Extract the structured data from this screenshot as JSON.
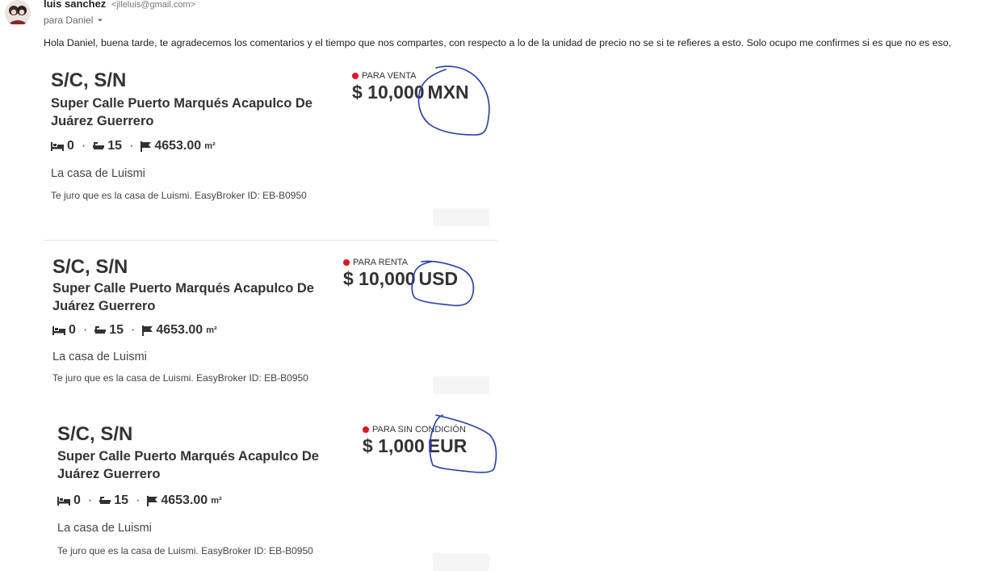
{
  "email": {
    "sender_name": "luis sanchez",
    "sender_email": "<jlleluis@gmail.com>",
    "recipient": "para Daniel",
    "body": "Hola Daniel, buena tarde, te agradecemos los comentarios y el tiempo que nos compartes, con respecto a lo de la unidad de precio no se si te refieres a esto. Solo ocupo me confirmes si es que no es eso,"
  },
  "listings": [
    {
      "address": "S/C, S/N",
      "street": "Super Calle Puerto Marqués Acapulco De Juárez Guerrero",
      "bedrooms": "0",
      "bathrooms": "15",
      "area": "4653.00",
      "area_unit": "m²",
      "summary": "La casa de Luismi",
      "description": "Te juro que es la casa de Luismi. EasyBroker ID: EB-B0950",
      "operation": "PARA VENTA",
      "price": "$ 10,000",
      "currency": "MXN"
    },
    {
      "address": "S/C, S/N",
      "street": "Super Calle Puerto Marqués Acapulco De Juárez Guerrero",
      "bedrooms": "0",
      "bathrooms": "15",
      "area": "4653.00",
      "area_unit": "m²",
      "summary": "La casa de Luismi",
      "description": "Te juro que es la casa de Luismi. EasyBroker ID: EB-B0950",
      "operation": "PARA RENTA",
      "price": "$ 10,000",
      "currency": "USD"
    },
    {
      "address": "S/C, S/N",
      "street": "Super Calle Puerto Marqués Acapulco De Juárez Guerrero",
      "bedrooms": "0",
      "bathrooms": "15",
      "area": "4653.00",
      "area_unit": "m²",
      "summary": "La casa de Luismi",
      "description": "Te juro que es la casa de Luismi. EasyBroker ID: EB-B0950",
      "operation": "PARA SIN CONDICIÓN",
      "price": "$ 1,000",
      "currency": "EUR"
    }
  ],
  "icons": {
    "bed": "bed-icon",
    "bath": "bathtub-icon",
    "area": "flag-icon",
    "status": "red-dot-icon"
  },
  "colors": {
    "status_dot": "#e8141b",
    "annotation": "#1f3bd6"
  }
}
